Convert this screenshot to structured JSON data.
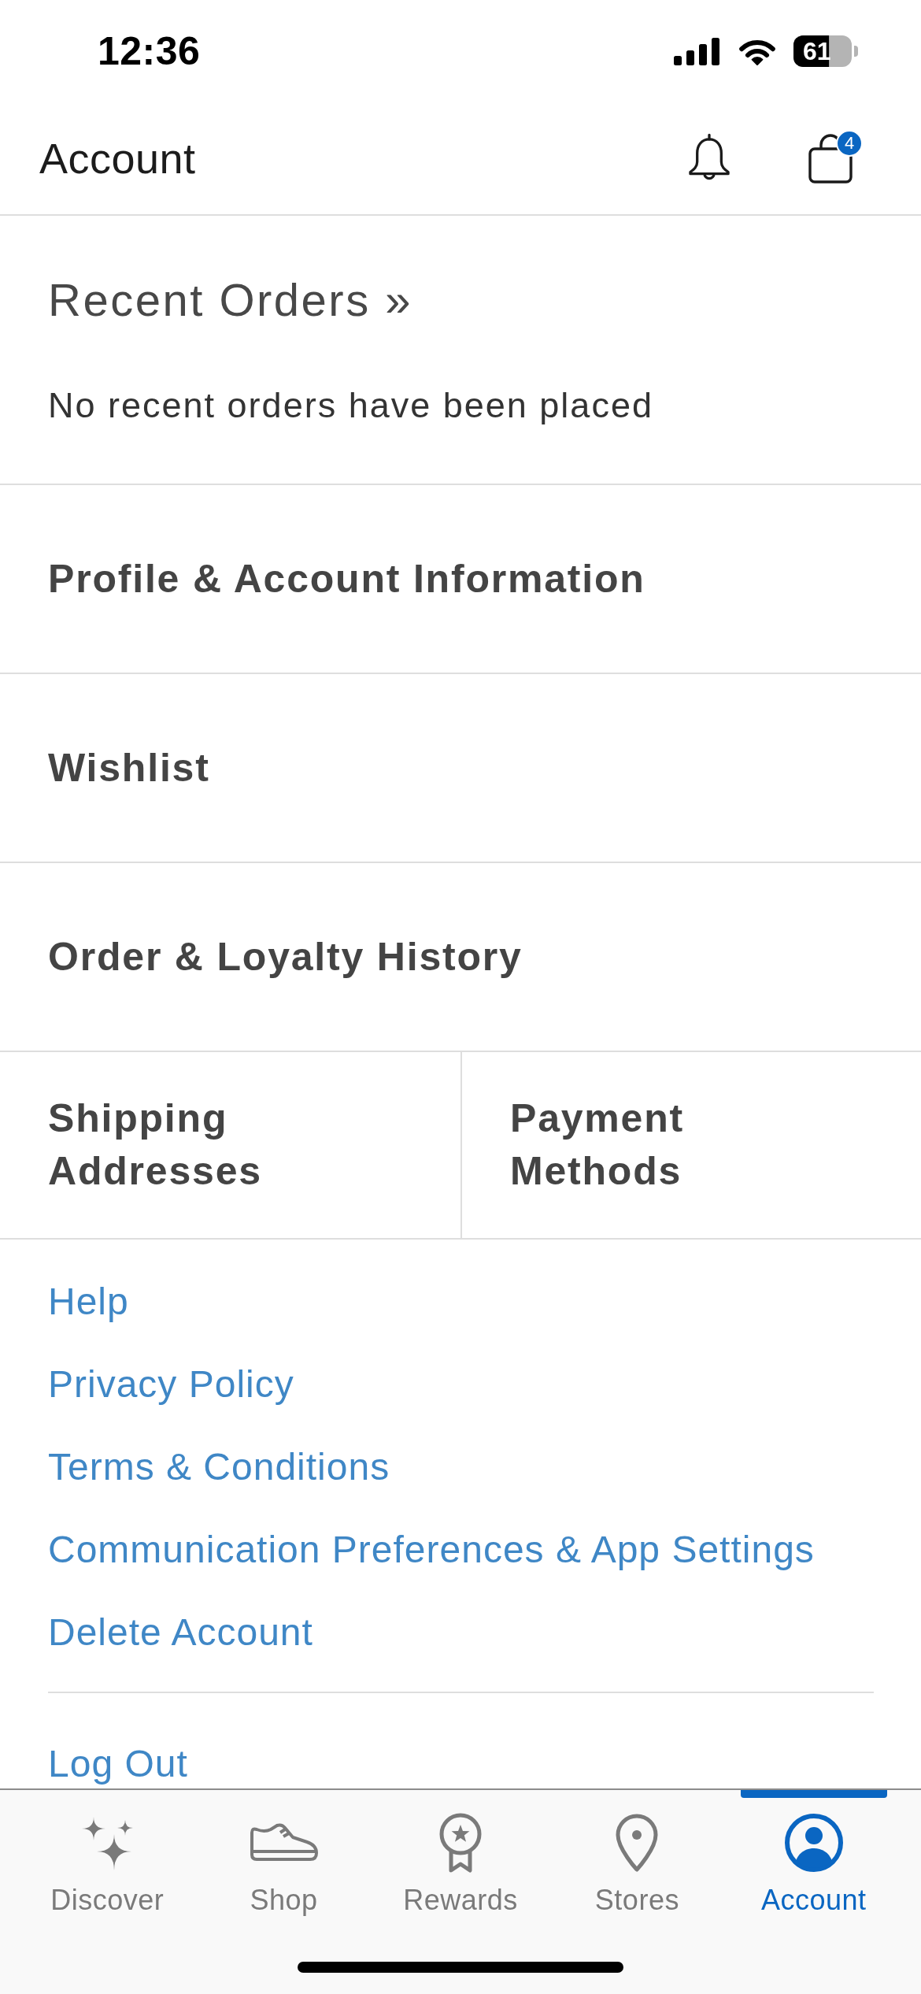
{
  "status_bar": {
    "time": "12:36",
    "battery": "61"
  },
  "header": {
    "title": "Account",
    "cart_count": "4"
  },
  "recent_orders": {
    "title": "Recent Orders »",
    "message": "No recent orders have been placed"
  },
  "menu_rows": [
    {
      "label": "Profile & Account Information"
    },
    {
      "label": "Wishlist"
    },
    {
      "label": "Order & Loyalty History"
    }
  ],
  "menu_tiles": [
    {
      "label": "Shipping Addresses"
    },
    {
      "label": "Payment Methods"
    }
  ],
  "links": [
    {
      "label": "Help"
    },
    {
      "label": "Privacy Policy"
    },
    {
      "label": "Terms & Conditions"
    },
    {
      "label": "Communication Preferences & App Settings"
    },
    {
      "label": "Delete Account"
    }
  ],
  "logout": {
    "label": "Log Out"
  },
  "tab_bar": [
    {
      "label": "Discover",
      "selected": false
    },
    {
      "label": "Shop",
      "selected": false
    },
    {
      "label": "Rewards",
      "selected": false
    },
    {
      "label": "Stores",
      "selected": false
    },
    {
      "label": "Account",
      "selected": true
    }
  ]
}
